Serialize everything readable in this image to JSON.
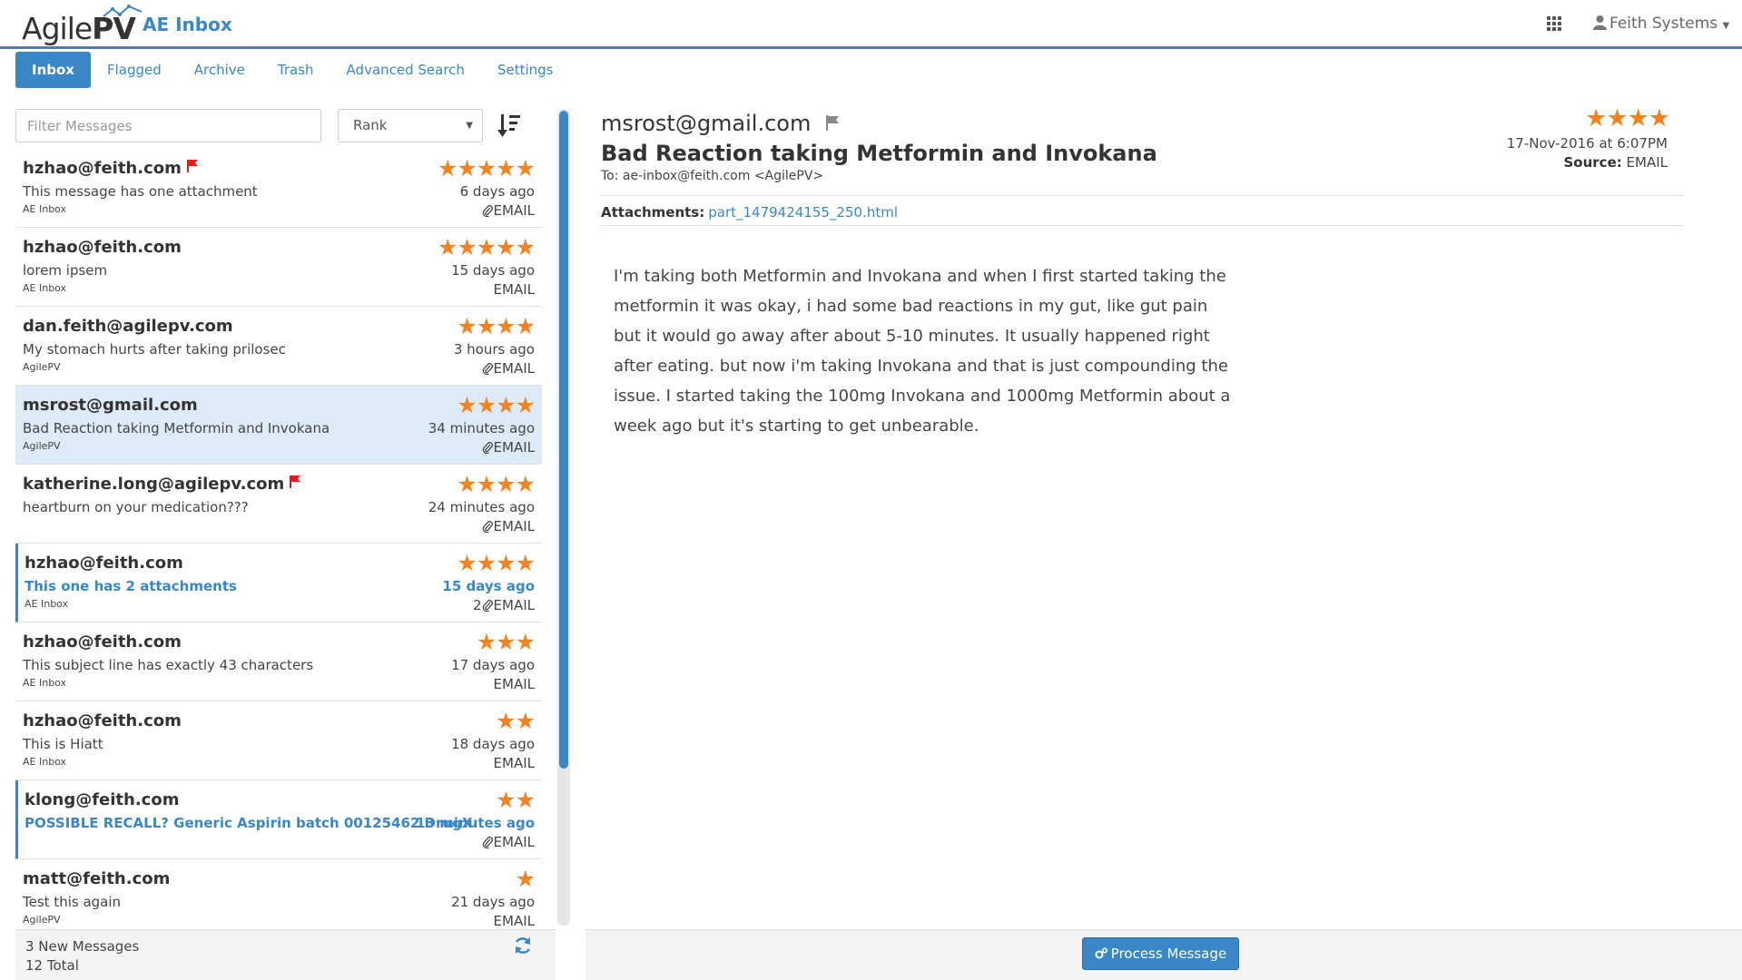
{
  "header": {
    "logo_part1": "Agile",
    "logo_part2": "PV",
    "app_title": "AE Inbox",
    "user_name": "Feith Systems",
    "accent_color": "#3a87c8"
  },
  "tabs": [
    {
      "label": "Inbox",
      "active": true
    },
    {
      "label": "Flagged"
    },
    {
      "label": "Archive"
    },
    {
      "label": "Trash"
    },
    {
      "label": "Advanced Search"
    },
    {
      "label": "Settings"
    }
  ],
  "list_controls": {
    "filter_placeholder": "Filter Messages",
    "sort_value": "Rank"
  },
  "messages": [
    {
      "sender": "hzhao@feith.com",
      "flagged": true,
      "subject": "This message has one attachment",
      "folder": "AE Inbox",
      "stars": "★★★★★",
      "time": "6 days ago",
      "attachments": "",
      "has_attachment": true,
      "source": "EMAIL",
      "selected": false,
      "unread": false
    },
    {
      "sender": "hzhao@feith.com",
      "flagged": false,
      "subject": "lorem ipsem",
      "folder": "AE Inbox",
      "stars": "★★★★★",
      "time": "15 days ago",
      "attachments": "",
      "has_attachment": false,
      "source": "EMAIL",
      "selected": false,
      "unread": false
    },
    {
      "sender": "dan.feith@agilepv.com",
      "flagged": false,
      "subject": "My stomach hurts after taking prilosec",
      "folder": "AgilePV",
      "stars": "★★★★",
      "time": "3 hours ago",
      "attachments": "",
      "has_attachment": true,
      "source": "EMAIL",
      "selected": false,
      "unread": false
    },
    {
      "sender": "msrost@gmail.com",
      "flagged": false,
      "subject": "Bad Reaction taking Metformin and Invokana",
      "folder": "AgilePV",
      "stars": "★★★★",
      "time": "34 minutes ago",
      "attachments": "",
      "has_attachment": true,
      "source": "EMAIL",
      "selected": true,
      "unread": false
    },
    {
      "sender": "katherine.long@agilepv.com",
      "flagged": true,
      "subject": "heartburn on your medication???",
      "folder": "",
      "stars": "★★★★",
      "time": "24 minutes ago",
      "attachments": "",
      "has_attachment": true,
      "source": "EMAIL",
      "selected": false,
      "unread": false
    },
    {
      "sender": "hzhao@feith.com",
      "flagged": false,
      "subject": "This one has 2 attachments",
      "folder": "AE Inbox",
      "stars": "★★★★",
      "time": "15 days ago",
      "attachments": "2",
      "has_attachment": true,
      "source": "EMAIL",
      "selected": false,
      "unread": true
    },
    {
      "sender": "hzhao@feith.com",
      "flagged": false,
      "subject": "This subject line has exactly 43 characters",
      "folder": "AE Inbox",
      "stars": "★★★",
      "time": "17 days ago",
      "attachments": "",
      "has_attachment": false,
      "source": "EMAIL",
      "selected": false,
      "unread": false
    },
    {
      "sender": "hzhao@feith.com",
      "flagged": false,
      "subject": "This is Hiatt",
      "folder": "AE Inbox",
      "stars": "★★",
      "time": "18 days ago",
      "attachments": "",
      "has_attachment": false,
      "source": "EMAIL",
      "selected": false,
      "unread": false
    },
    {
      "sender": "klong@feith.com",
      "flagged": false,
      "subject": "POSSIBLE RECALL? Generic Aspirin batch 00125462 DrugX",
      "folder": "",
      "stars": "★★",
      "time": "13 minutes ago",
      "attachments": "",
      "has_attachment": true,
      "source": "EMAIL",
      "selected": false,
      "unread": true
    },
    {
      "sender": "matt@feith.com",
      "flagged": false,
      "subject": "Test this again",
      "folder": "AgilePV",
      "stars": "★",
      "time": "21 days ago",
      "attachments": "",
      "has_attachment": false,
      "source": "EMAIL",
      "selected": false,
      "unread": false
    }
  ],
  "list_footer": {
    "new_count": "3 New Messages",
    "total": "12 Total"
  },
  "detail": {
    "from": "msrost@gmail.com",
    "subject": "Bad Reaction taking Metformin and Invokana",
    "to": "To: ae-inbox@feith.com <AgilePV>",
    "stars": "★★★★",
    "date": "17-Nov-2016 at 6:07PM",
    "source_label": "Source:",
    "source_value": "EMAIL",
    "attachments_label": "Attachments:",
    "attachment_file": "part_1479424155_250.html",
    "body": "I'm taking both Metformin and Invokana and when I first started taking the metformin it was okay, i had some bad reactions in my gut, like gut pain but it would go away after about 5-10 minutes. It usually happened right after eating. but now i'm taking Invokana and that is just compounding the issue. I started taking the 100mg Invokana and 1000mg Metformin about a week ago but it's starting to get unbearable.",
    "process_button": "Process Message"
  },
  "colors": {
    "star": "#f58220",
    "flag": "#e02020",
    "selected_row": "#dcebf7"
  }
}
